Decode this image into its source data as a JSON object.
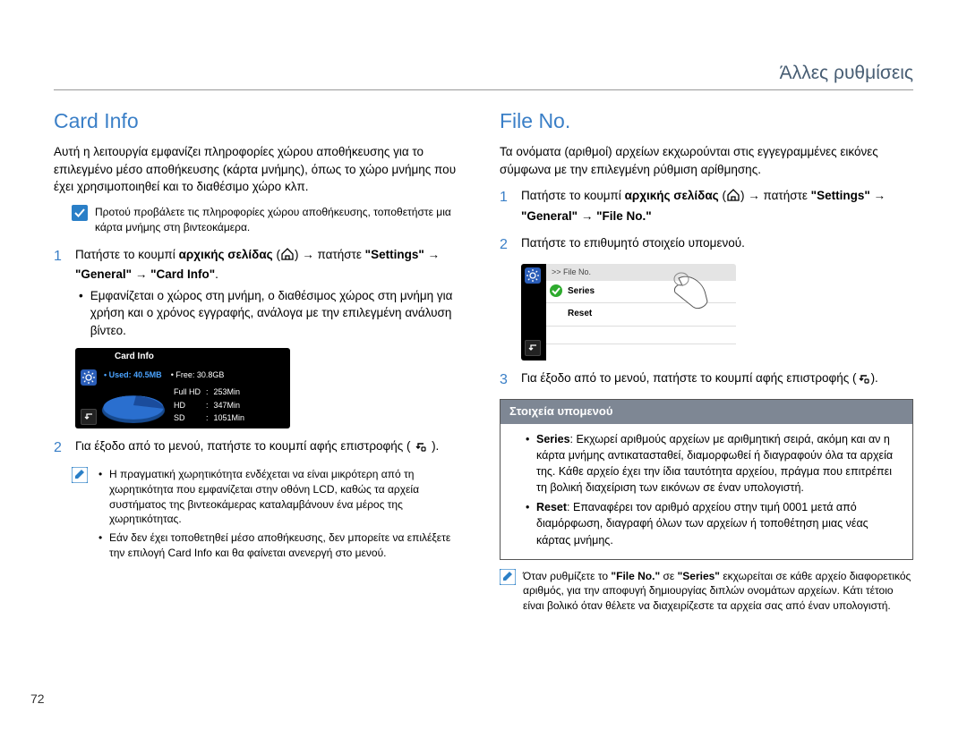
{
  "header": "Άλλες ρυθμίσεις",
  "pageNumber": "72",
  "col1": {
    "title": "Card Info",
    "intro": "Αυτή η λειτουργία εμφανίζει πληροφορίες χώρου αποθήκευσης για το επιλεγμένο μέσο αποθήκευσης (κάρτα μνήμης), όπως το χώρο μνήμης που έχει χρησιμοποιηθεί και το διαθέσιμο χώρο κλπ.",
    "preNote": "Προτού προβάλετε τις πληροφορίες χώρου αποθήκευσης, τοποθετήστε μια κάρτα μνήμης στη βιντεοκάμερα.",
    "step1_a": "Πατήστε το κουμπί ",
    "step1_bold1": "αρχικής σελίδας",
    "step1_b": " → πατήστε ",
    "step1_path": "\"Settings\" → \"General\" → \"Card Info\"",
    "step1_dot": ".",
    "step1_bullet": "Εμφανίζεται ο χώρος στη μνήμη, ο διαθέσιμος χώρος στη μνήμη για χρήση και ο χρόνος εγγραφής, ανάλογα με την επιλεγμένη ανάλυση βίντεο.",
    "shot": {
      "title": "Card Info",
      "used_label": "• Used: 40.5MB",
      "free_label": "• Free: 30.8GB",
      "rows": [
        {
          "k": "Full HD",
          "sep": ":",
          "v": "253Min"
        },
        {
          "k": "HD",
          "sep": ":",
          "v": "347Min"
        },
        {
          "k": "SD",
          "sep": ":",
          "v": "1051Min"
        }
      ]
    },
    "step2_a": "Για έξοδο από το μενού, πατήστε το κουμπί αφής επιστροφής ( ",
    "step2_b": " ).",
    "bottomNotes": [
      "Η πραγματική χωρητικότητα ενδέχεται να είναι μικρότερη από τη χωρητικότητα που εμφανίζεται στην οθόνη LCD, καθώς τα αρχεία συστήματος της βιντεοκάμερας καταλαμβάνουν ένα μέρος της χωρητικότητας.",
      "Εάν δεν έχει τοποθετηθεί μέσο αποθήκευσης, δεν μπορείτε να επιλέξετε την επιλογή Card Info και θα φαίνεται ανενεργή στο μενού."
    ]
  },
  "col2": {
    "title": "File No.",
    "intro": "Τα ονόματα (αριθμοί) αρχείων εκχωρούνται στις εγγεγραμμένες εικόνες σύμφωνα με την επιλεγμένη ρύθμιση αρίθμησης.",
    "step1_a": "Πατήστε το κουμπί ",
    "step1_bold1": "αρχικής σελίδας",
    "step1_b": " → πατήστε ",
    "step1_path": "\"Settings\" → \"General\" → \"File No.\"",
    "step2": "Πατήστε το επιθυμητό στοιχείο υπομενού.",
    "shot": {
      "crumb": ">> File No.",
      "items": [
        "Series",
        "Reset"
      ]
    },
    "step3_a": "Για έξοδο από το μενού, πατήστε το κουμπί αφής επιστροφής (",
    "step3_b": ").",
    "submenuTitle": "Στοιχεία υπομενού",
    "submenuItems": [
      {
        "name": "Series",
        "desc": ": Εκχωρεί αριθμούς αρχείων με αριθμητική σειρά, ακόμη και αν η κάρτα μνήμης αντικατασταθεί, διαμορφωθεί ή διαγραφούν όλα τα αρχεία της. Κάθε αρχείο έχει την ίδια ταυτότητα αρχείου, πράγμα που επιτρέπει τη βολική διαχείριση των εικόνων σε έναν υπολογιστή."
      },
      {
        "name": "Reset",
        "desc": ": Επαναφέρει τον αριθμό αρχείου στην τιμή 0001 μετά από διαμόρφωση, διαγραφή όλων των αρχείων ή τοποθέτηση μιας νέας κάρτας μνήμης."
      }
    ],
    "bottomNote_a": "Όταν ρυθμίζετε το ",
    "bottomNote_b": "\"File No.\"",
    "bottomNote_c": " σε ",
    "bottomNote_d": "\"Series\"",
    "bottomNote_e": " εκχωρείται σε κάθε αρχείο διαφορετικός αριθμός, για την αποφυγή δημιουργίας διπλών ονομάτων αρχείων. Κάτι τέτοιο είναι βολικό όταν θέλετε να διαχειρίζεστε τα αρχεία σας από έναν υπολογιστή."
  }
}
